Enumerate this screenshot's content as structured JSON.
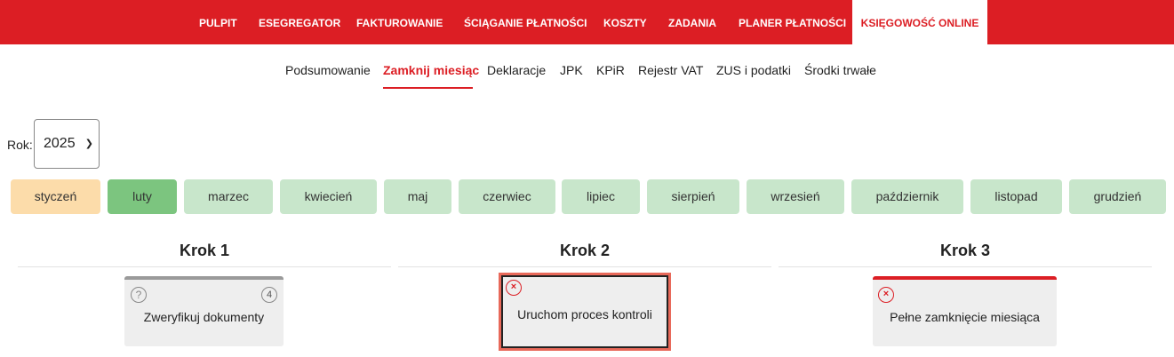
{
  "top_nav": {
    "items": [
      {
        "label": "PULPIT"
      },
      {
        "label": "ESEGREGATOR"
      },
      {
        "label": "FAKTUROWANIE"
      },
      {
        "label": "ŚCIĄGANIE PŁATNOŚCI"
      },
      {
        "label": "KOSZTY"
      },
      {
        "label": "ZADANIA"
      },
      {
        "label": "PLANER PŁATNOŚCI"
      },
      {
        "label": "KSIĘGOWOŚĆ ONLINE",
        "active": true
      }
    ]
  },
  "sub_nav": {
    "items": [
      {
        "label": "Podsumowanie"
      },
      {
        "label": "Zamknij miesiąc",
        "active": true
      },
      {
        "label": "Deklaracje"
      },
      {
        "label": "JPK"
      },
      {
        "label": "KPiR"
      },
      {
        "label": "Rejestr VAT"
      },
      {
        "label": "ZUS i podatki"
      },
      {
        "label": "Środki trwałe"
      }
    ]
  },
  "year": {
    "label": "Rok:",
    "value": "2025"
  },
  "months": [
    {
      "label": "styczeń",
      "state": "previous"
    },
    {
      "label": "luty",
      "state": "current"
    },
    {
      "label": "marzec"
    },
    {
      "label": "kwiecień"
    },
    {
      "label": "maj"
    },
    {
      "label": "czerwiec"
    },
    {
      "label": "lipiec"
    },
    {
      "label": "sierpień"
    },
    {
      "label": "wrzesień"
    },
    {
      "label": "październik"
    },
    {
      "label": "listopad"
    },
    {
      "label": "grudzień"
    }
  ],
  "steps": [
    {
      "title": "Krok 1",
      "card": {
        "label": "Zweryfikuj dokumenty",
        "status_icon": "question-icon",
        "status_symbol": "?",
        "count": "4"
      }
    },
    {
      "title": "Krok 2",
      "card": {
        "label": "Uruchom proces kontroli",
        "status_icon": "error-icon",
        "status_symbol": "×"
      }
    },
    {
      "title": "Krok 3",
      "card": {
        "label": "Pełne zamknięcie miesiąca",
        "status_icon": "error-icon",
        "status_symbol": "×"
      }
    }
  ],
  "colors": {
    "brand_red": "#dc1e24",
    "month_default": "#c8e6cb",
    "month_current": "#7cc57f",
    "month_previous": "#fcdcaa",
    "card_bg": "#eeeeee",
    "highlight_box": "#e8695a"
  }
}
